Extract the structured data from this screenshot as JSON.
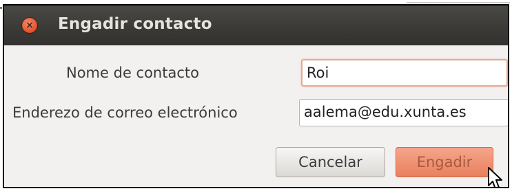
{
  "dialog": {
    "title": "Engadir contacto",
    "close_icon": "close-icon"
  },
  "form": {
    "name_label": "Nome de contacto",
    "name_value": "Roi",
    "email_label": "Enderezo de correo electrónico",
    "email_value": "aalema@edu.xunta.es"
  },
  "buttons": {
    "cancel_label": "Cancelar",
    "add_label": "Engadir"
  },
  "colors": {
    "titlebar": "#3a3935",
    "close_button": "#e0502a",
    "accent_button": "#e8805e"
  }
}
